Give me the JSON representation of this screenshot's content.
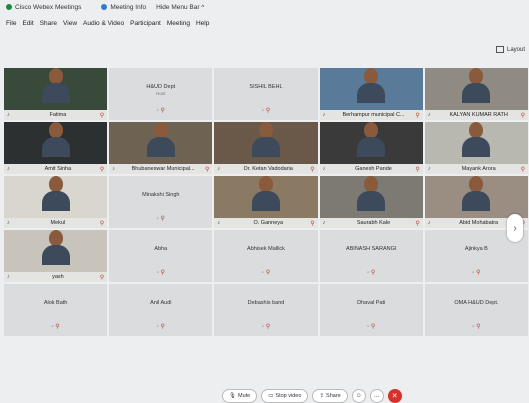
{
  "topbar": {
    "app_label": "Cisco Webex Meetings",
    "meeting_info_label": "Meeting Info",
    "hide_menu_label": "Hide Menu Bar ^"
  },
  "menu": [
    "File",
    "Edit",
    "Share",
    "View",
    "Audio & Video",
    "Participant",
    "Meeting",
    "Help"
  ],
  "layout_label": "Layout",
  "tiles": [
    {
      "type": "video",
      "name": "Fatima",
      "bg": "#3a4a3a"
    },
    {
      "type": "name",
      "name": "H&UD Dept",
      "sub": "Host"
    },
    {
      "type": "name",
      "name": "SISHIL BEHL"
    },
    {
      "type": "video",
      "name": "Berhampur municipal C...",
      "bg": "#5a7a9a"
    },
    {
      "type": "video",
      "name": "KALYAN KUMAR RATH",
      "bg": "#8f8a82"
    },
    {
      "type": "video",
      "name": "Amit Sinha",
      "bg": "#2c3030"
    },
    {
      "type": "video",
      "name": "Bhubaneswar Municipal...",
      "bg": "#6e6252"
    },
    {
      "type": "video",
      "name": "Dr. Ketan Vadodaria",
      "bg": "#6a5848"
    },
    {
      "type": "video",
      "name": "Ganesh Pande",
      "bg": "#3a3a3a"
    },
    {
      "type": "video",
      "name": "Mayank Arora",
      "bg": "#b8b8b0"
    },
    {
      "type": "video",
      "name": "Mekul",
      "bg": "#d9d6d0"
    },
    {
      "type": "name",
      "name": "Minakshi Singh"
    },
    {
      "type": "video",
      "name": "O. Ganneya",
      "bg": "#8a7a64"
    },
    {
      "type": "video",
      "name": "Saurabh Kale",
      "bg": "#7c7a72"
    },
    {
      "type": "video",
      "name": "Abid Mohabatra",
      "bg": "#9a8e82"
    },
    {
      "type": "video",
      "name": "yash",
      "bg": "#c8c4bc"
    },
    {
      "type": "name",
      "name": "Abha"
    },
    {
      "type": "name",
      "name": "Abhisek Mallick"
    },
    {
      "type": "name",
      "name": "ABINASH SARANGI"
    },
    {
      "type": "name",
      "name": "Ajinkya B"
    },
    {
      "type": "name",
      "name": "Alok Bath"
    },
    {
      "type": "name",
      "name": "Anil Audi"
    },
    {
      "type": "name",
      "name": "Debashis band"
    },
    {
      "type": "name",
      "name": "Dhaval Pati"
    },
    {
      "type": "name",
      "name": "OMA H&UD Dept."
    }
  ],
  "controls": {
    "mute_label": "Mute",
    "video_label": "Stop video",
    "share_label": "Share"
  },
  "colors": {
    "end_button": "#d9302c",
    "mute_red": "#c0392b"
  }
}
